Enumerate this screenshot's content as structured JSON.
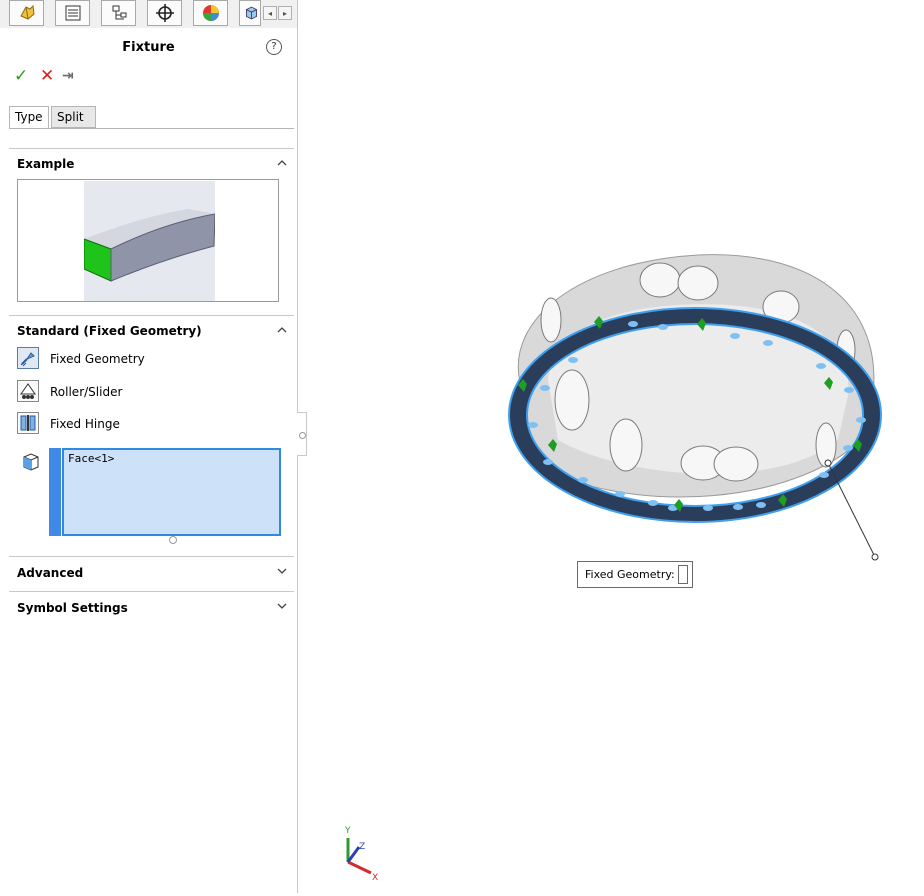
{
  "window": {
    "title": "Fixture",
    "help_icon": "question-circle-icon"
  },
  "tab_strip": {
    "tabs": [
      {
        "name": "simulation-study-tab",
        "icon": "simulation-icon"
      },
      {
        "name": "property-manager-tab",
        "icon": "property-list-icon"
      },
      {
        "name": "configuration-manager-tab",
        "icon": "configuration-icon"
      },
      {
        "name": "dimxpert-tab",
        "icon": "crosshair-icon"
      },
      {
        "name": "display-manager-tab",
        "icon": "appearance-ball-icon"
      },
      {
        "name": "cam-tab",
        "icon": "cube-icon"
      }
    ],
    "scroll_left": "◂",
    "scroll_right": "▸"
  },
  "actions": {
    "ok": "✓",
    "cancel": "✕",
    "pin": "⇥"
  },
  "tabs": [
    {
      "label": "Type",
      "selected": true
    },
    {
      "label": "Split",
      "selected": false
    }
  ],
  "sections": {
    "example": {
      "title": "Example",
      "expanded": true
    },
    "standard": {
      "title": "Standard (Fixed Geometry)",
      "expanded": true,
      "options": [
        {
          "label": "Fixed Geometry",
          "selected": true,
          "icon": "fixed-geometry-icon"
        },
        {
          "label": "Roller/Slider",
          "selected": false,
          "icon": "roller-slider-icon"
        },
        {
          "label": "Fixed Hinge",
          "selected": false,
          "icon": "fixed-hinge-icon"
        }
      ],
      "selection_items": [
        "Face<1>"
      ]
    },
    "advanced": {
      "title": "Advanced",
      "expanded": false
    },
    "symbol_settings": {
      "title": "Symbol Settings",
      "expanded": false
    }
  },
  "viewport": {
    "callout_label": "Fixed Geometry:",
    "triad": {
      "y": "Y",
      "z": "Z",
      "x": "X"
    }
  },
  "colors": {
    "selection_blue": "#3f8ae6",
    "fixture_green": "#1e9e23",
    "ok_green": "#2f9e1d",
    "cancel_red": "#d61f1f"
  }
}
